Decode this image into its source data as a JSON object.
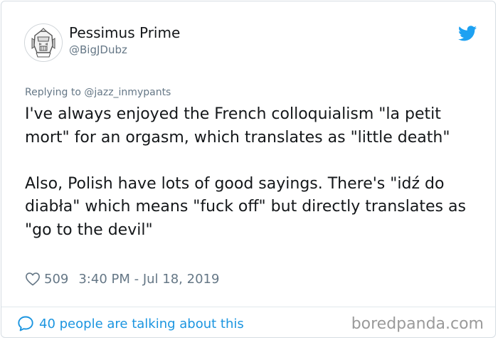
{
  "account": {
    "display_name": "Pessimus Prime",
    "handle": "@BigJDubz",
    "avatar_icon": "robot-helmet-icon"
  },
  "tweet": {
    "replying_to": "Replying to @jazz_inmypants",
    "paragraph_1": "I've always enjoyed the French colloquialism \"la petit mort\" for an orgasm, which translates as \"little death\"",
    "paragraph_2": "Also, Polish have lots of good sayings. There's \"idź do diabła\" which means \"fuck off\" but directly translates as \"go to the devil\"",
    "likes": "509",
    "timestamp": "3:40 PM - Jul 18, 2019"
  },
  "footer": {
    "talking_label": "40 people are talking about this",
    "watermark": "boredpanda.com"
  },
  "colors": {
    "text": "#14171a",
    "muted": "#657786",
    "accent": "#1b95e0",
    "border": "#e1e8ed",
    "watermark": "#9a9a9a"
  },
  "icons": {
    "brand": "twitter-bird-icon",
    "like": "heart-icon",
    "conversation": "speech-bubble-icon"
  }
}
